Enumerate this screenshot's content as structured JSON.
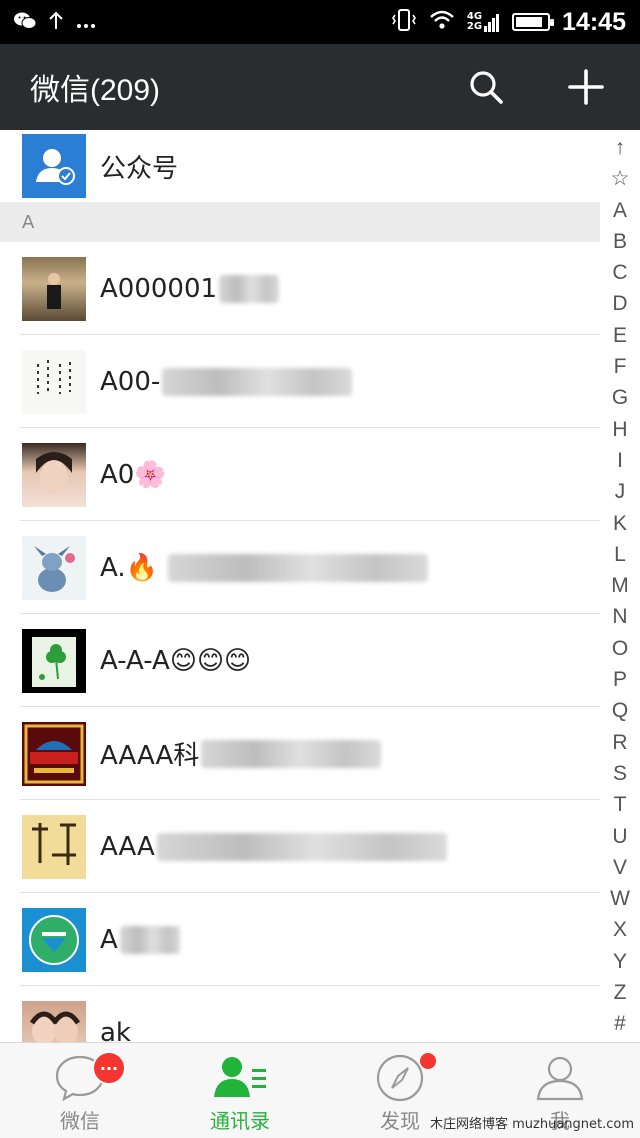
{
  "status_bar": {
    "time": "14:45",
    "network": [
      "4G",
      "2G"
    ],
    "left_icons": [
      "wechat-icon",
      "upload-arrow-icon",
      "more-dots-icon"
    ],
    "battery_level": 0.85
  },
  "header": {
    "title": "微信(209)",
    "buttons": [
      "search-icon",
      "add-icon"
    ]
  },
  "list": {
    "top_item": {
      "label": "公众号",
      "avatar_color": "#2a7fd4"
    },
    "section_header": "A",
    "contacts": [
      {
        "name": "A000001",
        "blurred": true
      },
      {
        "name": "A00-",
        "blurred": true
      },
      {
        "name": "A0🌸",
        "blurred": false
      },
      {
        "name": "A.🔥",
        "blurred": true
      },
      {
        "name": "A-A-A😊😊😊",
        "blurred": false
      },
      {
        "name": "AAAA科",
        "blurred": true
      },
      {
        "name": "AAA",
        "blurred": true
      },
      {
        "name": "A",
        "blurred": true
      },
      {
        "name": "ak",
        "blurred": false
      }
    ]
  },
  "index_bar": [
    "↑",
    "☆",
    "A",
    "B",
    "C",
    "D",
    "E",
    "F",
    "G",
    "H",
    "I",
    "J",
    "K",
    "L",
    "M",
    "N",
    "O",
    "P",
    "Q",
    "R",
    "S",
    "T",
    "U",
    "V",
    "W",
    "X",
    "Y",
    "Z",
    "#"
  ],
  "tabs": [
    {
      "label": "微信",
      "icon": "chat-bubble-icon",
      "badge": "···",
      "active": false
    },
    {
      "label": "通讯录",
      "icon": "contacts-icon",
      "active": true
    },
    {
      "label": "发现",
      "icon": "compass-icon",
      "dot": true,
      "active": false
    },
    {
      "label": "我",
      "icon": "person-icon",
      "active": false
    }
  ],
  "watermark": "木庄网络博客 muzhuangnet.com",
  "colors": {
    "accent": "#21b33a",
    "header_bg": "#2a2d2f",
    "badge": "#f43530"
  }
}
